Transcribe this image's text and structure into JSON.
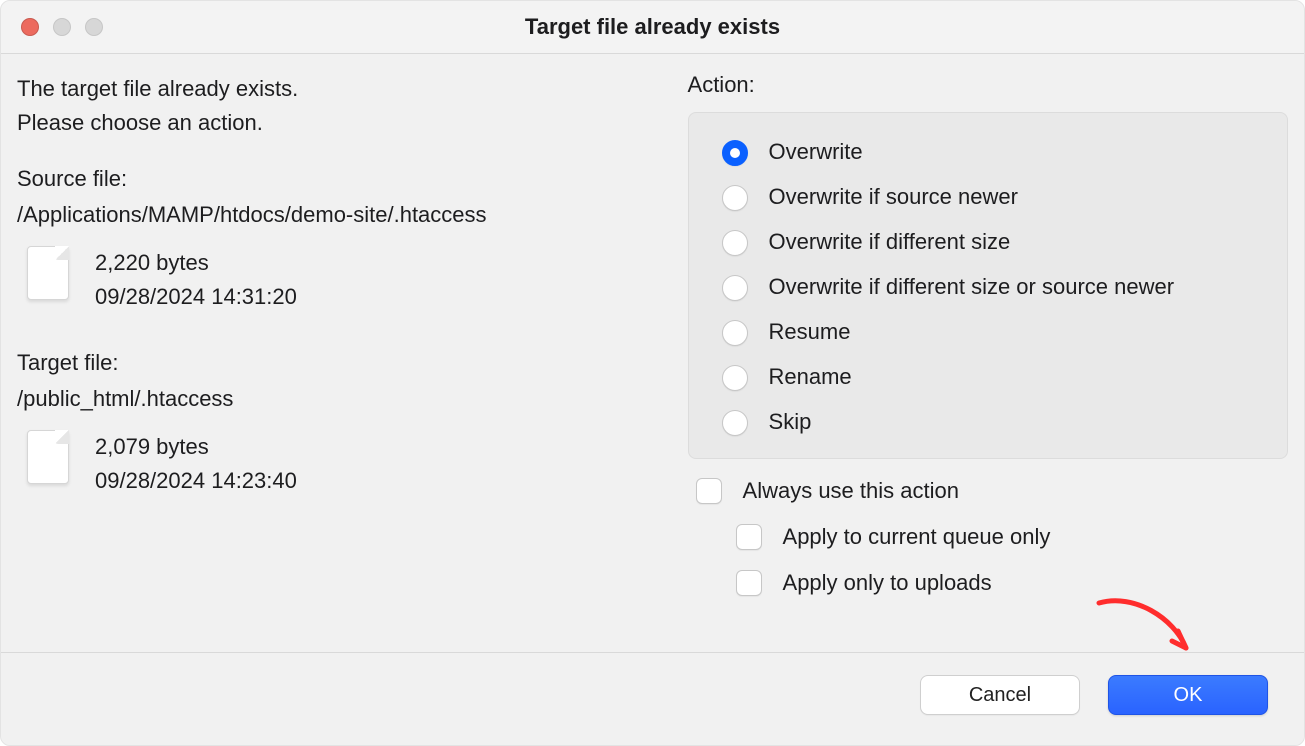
{
  "window": {
    "title": "Target file already exists"
  },
  "message": {
    "line1": "The target file already exists.",
    "line2": "Please choose an action."
  },
  "source": {
    "label": "Source file:",
    "path": "/Applications/MAMP/htdocs/demo-site/.htaccess",
    "size": "2,220 bytes",
    "mtime": "09/28/2024 14:31:20"
  },
  "target": {
    "label": "Target file:",
    "path": "/public_html/.htaccess",
    "size": "2,079 bytes",
    "mtime": "09/28/2024 14:23:40"
  },
  "action": {
    "label": "Action:",
    "options": {
      "overwrite": "Overwrite",
      "overwrite_newer": "Overwrite if source newer",
      "overwrite_size": "Overwrite if different size",
      "overwrite_size_or_newer": "Overwrite if different size or source newer",
      "resume": "Resume",
      "rename": "Rename",
      "skip": "Skip"
    },
    "selected": "overwrite"
  },
  "checks": {
    "always": "Always use this action",
    "queue_only": "Apply to current queue only",
    "uploads_only": "Apply only to uploads"
  },
  "buttons": {
    "cancel": "Cancel",
    "ok": "OK"
  }
}
